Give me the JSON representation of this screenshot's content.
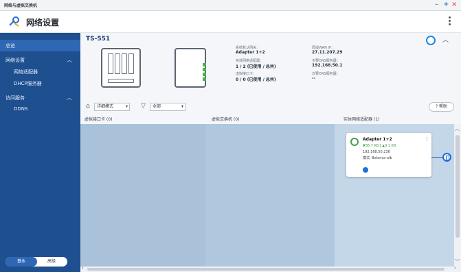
{
  "window": {
    "title": "网络与虚拟交换机",
    "controls": {
      "minimize": "–",
      "maximize": "+",
      "close": "×"
    }
  },
  "app": {
    "title": "网络设置",
    "icon": "network-settings-icon"
  },
  "sidebar": {
    "items": [
      {
        "label": "总览",
        "active": true
      },
      {
        "label": "网络设置",
        "expandable": true
      },
      {
        "label": "网络适配器"
      },
      {
        "label": "DHCP服务器"
      },
      {
        "label": "访问服务",
        "expandable": true
      },
      {
        "label": "DDNS"
      }
    ],
    "mode_basic": "基本",
    "mode_advanced": "高级"
  },
  "device": {
    "name": "TS-551",
    "default_gateway_label": "系统默认网关：",
    "default_gateway_value": "Adapter 1+2",
    "wan_ip_label": "局域WAN IP：",
    "wan_ip_value": "27.11.207.29",
    "physical_adapters_label": "实体网络适配器：",
    "physical_adapters_value": "1 / 2 (已使用 / 总共)",
    "primary_dns_label": "主要DNS服务器：",
    "primary_dns_value": "192.168.50.1",
    "virtual_adapters_label": "虚拟接口卡：",
    "virtual_adapters_value": "0 / 0 (已使用 / 总共)",
    "secondary_dns_label": "次要DNS服务器：",
    "secondary_dns_value": "--"
  },
  "toolbar": {
    "view_mode": "详细模式",
    "filter": "全部",
    "help": "帮助"
  },
  "columns": {
    "virtual_nics": "虚拟接口卡 (0)",
    "virtual_switches": "虚拟交换机 (0)",
    "physical_adapters": "实体网络适配器 (1)"
  },
  "adapter": {
    "name": "Adapter 1+2",
    "tx": "▼36.7 KB",
    "rx": "▲9.1 KB",
    "ip": "192.168.50.236",
    "mode": "模式: Balance-alb"
  },
  "colors": {
    "sidebar": "#1e4f8f",
    "sidebar_active": "#2f67b3",
    "accent": "#1e6fd9",
    "status_ok": "#43a047"
  }
}
